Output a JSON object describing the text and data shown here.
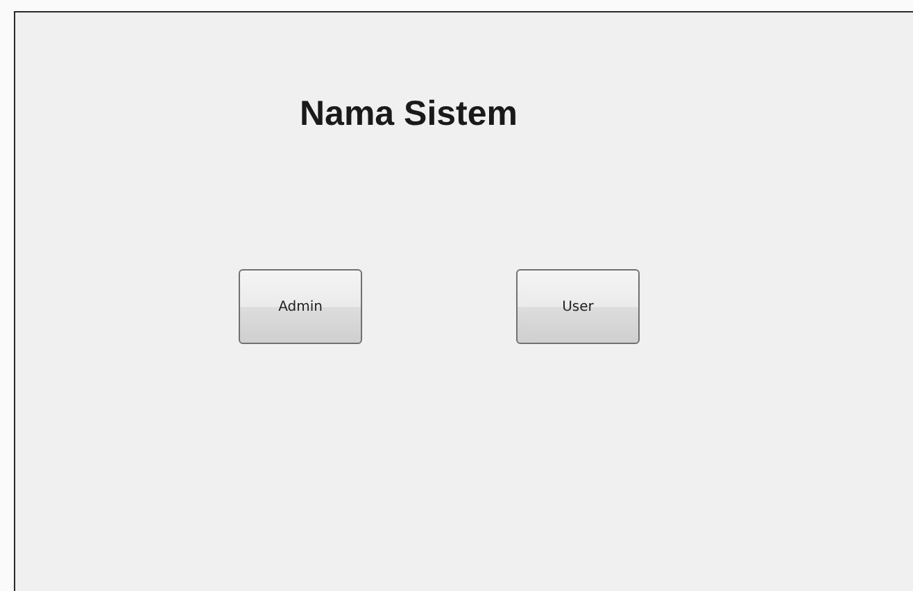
{
  "title": "Nama Sistem",
  "buttons": [
    {
      "label": "Admin"
    },
    {
      "label": "User"
    }
  ]
}
